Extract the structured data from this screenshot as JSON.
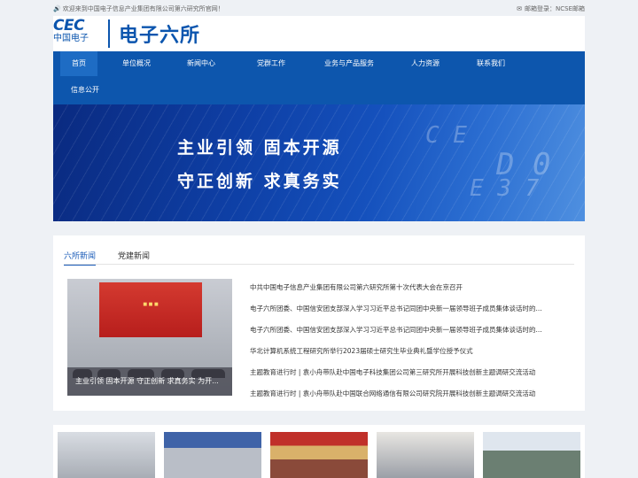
{
  "topbar": {
    "welcome": "欢迎来到中国电子信息产业集团有限公司第六研究所官网！",
    "mail": "邮箱登录：NCSE邮箱"
  },
  "header": {
    "logo_main": "CEC",
    "logo_sub": "中国电子",
    "site_name": "电子六所"
  },
  "nav": {
    "items": [
      {
        "label": "首页"
      },
      {
        "label": "单位概况"
      },
      {
        "label": "新闻中心"
      },
      {
        "label": "党群工作"
      },
      {
        "label": "业务与产品服务"
      },
      {
        "label": "人力资源"
      },
      {
        "label": "联系我们"
      },
      {
        "label": "信息公开"
      }
    ]
  },
  "banner": {
    "line1": "主业引领  固本开源",
    "line2": "守正创新  求真务实"
  },
  "news": {
    "tabs": [
      {
        "label": "六所新闻"
      },
      {
        "label": "党建新闻"
      }
    ],
    "feature_caption": "主业引领 固本开源 守正创新 求真务实 为开...",
    "items": [
      {
        "title": "中共中国电子信息产业集团有限公司第六研究所第十次代表大会在京召开"
      },
      {
        "title": "电子六所团委、中国信安团支部深入学习习近平总书记同团中央新一届领导班子成员集体谈话时的..."
      },
      {
        "title": "电子六所团委、中国信安团支部深入学习习近平总书记同团中央新一届领导班子成员集体谈话时的..."
      },
      {
        "title": "华北计算机系统工程研究所举行2023届硕士研究生毕业典礼暨学位授予仪式"
      },
      {
        "title": "主题教育进行时 | 袁小舟带队赴中国电子科技集团公司第三研究所开展科技创新主题调研交流活动"
      },
      {
        "title": "主题教育进行时 | 袁小舟带队赴中国联合网络通信有限公司研究院开展科技创新主题调研交流活动"
      }
    ]
  },
  "colors": {
    "brand_blue": "#0d56ad",
    "nav_active": "#1e6cc4"
  }
}
